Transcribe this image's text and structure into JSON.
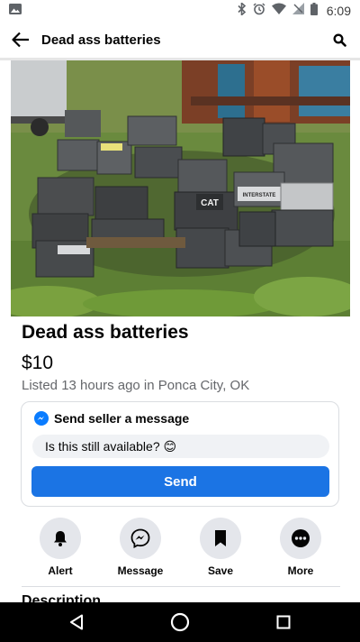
{
  "status_bar": {
    "time": "6:09",
    "icons": [
      "image-icon",
      "bluetooth-icon",
      "alarm-icon",
      "wifi-icon",
      "no-signal-icon",
      "battery-icon"
    ]
  },
  "header": {
    "title": "Dead ass batteries",
    "back_icon": "arrow-left-icon",
    "search_icon": "search-icon"
  },
  "photo": {
    "depicts": "pile of used car batteries on grass",
    "visible_brands": [
      "CAT",
      "INTERSTATE"
    ]
  },
  "listing": {
    "title": "Dead ass batteries",
    "price": "$10",
    "meta": "Listed 13 hours ago in Ponca City, OK"
  },
  "message_card": {
    "heading": "Send seller a message",
    "icon": "messenger-icon",
    "input_value": "Is this still available? 😊",
    "send_label": "Send"
  },
  "actions": [
    {
      "label": "Alert",
      "icon": "bell-icon"
    },
    {
      "label": "Message",
      "icon": "messenger-icon"
    },
    {
      "label": "Save",
      "icon": "bookmark-icon"
    },
    {
      "label": "More",
      "icon": "more-dots-icon"
    }
  ],
  "description": {
    "heading": "Description"
  },
  "colors": {
    "accent": "#1b74e4",
    "messenger": "#0a7cff",
    "action_bg": "#e4e6eb",
    "secondary_text": "#65676b"
  },
  "nav_bar": {
    "buttons": [
      "back-triangle-icon",
      "home-circle-icon",
      "recents-square-icon"
    ]
  }
}
